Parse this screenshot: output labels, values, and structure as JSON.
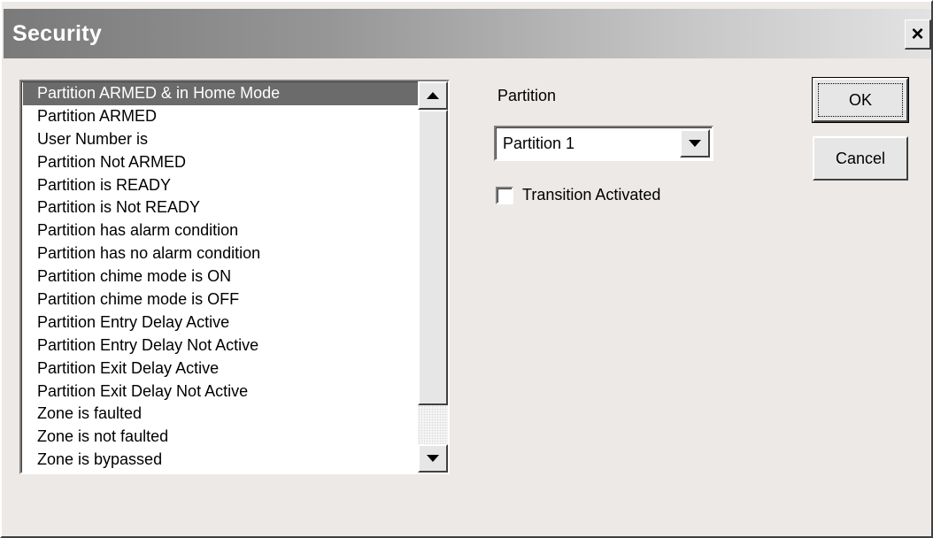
{
  "window": {
    "title": "Security",
    "close_symbol": "×"
  },
  "conditions_list": {
    "selected_index": 0,
    "items": [
      "Partition ARMED & in Home Mode",
      "Partition ARMED",
      "User Number is",
      "Partition Not ARMED",
      "Partition is READY",
      "Partition is Not READY",
      "Partition has alarm condition",
      "Partition has no alarm condition",
      "Partition chime mode is ON",
      "Partition chime mode is OFF",
      "Partition Entry Delay Active",
      "Partition Entry Delay Not Active",
      "Partition Exit Delay Active",
      "Partition Exit Delay Not Active",
      "Zone is faulted",
      "Zone is not faulted",
      "Zone is bypassed"
    ]
  },
  "partition": {
    "label": "Partition",
    "selected": "Partition 1"
  },
  "transition": {
    "label": "Transition Activated",
    "checked": false
  },
  "buttons": {
    "ok": "OK",
    "cancel": "Cancel"
  },
  "icons": {
    "close": "close-icon",
    "scroll_up": "arrow-up-icon",
    "scroll_down": "arrow-down-icon",
    "dropdown": "chevron-down-icon"
  }
}
